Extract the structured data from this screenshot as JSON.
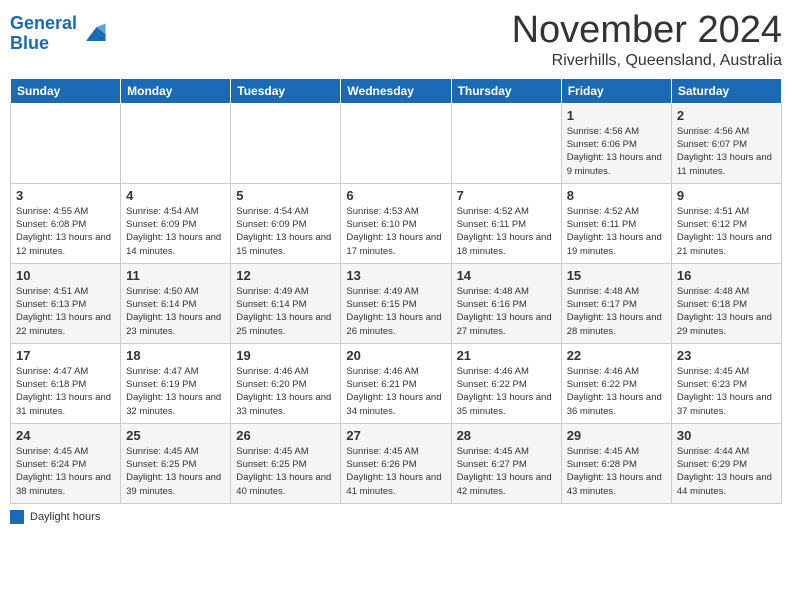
{
  "header": {
    "logo_line1": "General",
    "logo_line2": "Blue",
    "month": "November 2024",
    "location": "Riverhills, Queensland, Australia"
  },
  "days_of_week": [
    "Sunday",
    "Monday",
    "Tuesday",
    "Wednesday",
    "Thursday",
    "Friday",
    "Saturday"
  ],
  "weeks": [
    [
      {
        "day": "",
        "info": ""
      },
      {
        "day": "",
        "info": ""
      },
      {
        "day": "",
        "info": ""
      },
      {
        "day": "",
        "info": ""
      },
      {
        "day": "",
        "info": ""
      },
      {
        "day": "1",
        "info": "Sunrise: 4:56 AM\nSunset: 6:06 PM\nDaylight: 13 hours and 9 minutes."
      },
      {
        "day": "2",
        "info": "Sunrise: 4:56 AM\nSunset: 6:07 PM\nDaylight: 13 hours and 11 minutes."
      }
    ],
    [
      {
        "day": "3",
        "info": "Sunrise: 4:55 AM\nSunset: 6:08 PM\nDaylight: 13 hours and 12 minutes."
      },
      {
        "day": "4",
        "info": "Sunrise: 4:54 AM\nSunset: 6:09 PM\nDaylight: 13 hours and 14 minutes."
      },
      {
        "day": "5",
        "info": "Sunrise: 4:54 AM\nSunset: 6:09 PM\nDaylight: 13 hours and 15 minutes."
      },
      {
        "day": "6",
        "info": "Sunrise: 4:53 AM\nSunset: 6:10 PM\nDaylight: 13 hours and 17 minutes."
      },
      {
        "day": "7",
        "info": "Sunrise: 4:52 AM\nSunset: 6:11 PM\nDaylight: 13 hours and 18 minutes."
      },
      {
        "day": "8",
        "info": "Sunrise: 4:52 AM\nSunset: 6:11 PM\nDaylight: 13 hours and 19 minutes."
      },
      {
        "day": "9",
        "info": "Sunrise: 4:51 AM\nSunset: 6:12 PM\nDaylight: 13 hours and 21 minutes."
      }
    ],
    [
      {
        "day": "10",
        "info": "Sunrise: 4:51 AM\nSunset: 6:13 PM\nDaylight: 13 hours and 22 minutes."
      },
      {
        "day": "11",
        "info": "Sunrise: 4:50 AM\nSunset: 6:14 PM\nDaylight: 13 hours and 23 minutes."
      },
      {
        "day": "12",
        "info": "Sunrise: 4:49 AM\nSunset: 6:14 PM\nDaylight: 13 hours and 25 minutes."
      },
      {
        "day": "13",
        "info": "Sunrise: 4:49 AM\nSunset: 6:15 PM\nDaylight: 13 hours and 26 minutes."
      },
      {
        "day": "14",
        "info": "Sunrise: 4:48 AM\nSunset: 6:16 PM\nDaylight: 13 hours and 27 minutes."
      },
      {
        "day": "15",
        "info": "Sunrise: 4:48 AM\nSunset: 6:17 PM\nDaylight: 13 hours and 28 minutes."
      },
      {
        "day": "16",
        "info": "Sunrise: 4:48 AM\nSunset: 6:18 PM\nDaylight: 13 hours and 29 minutes."
      }
    ],
    [
      {
        "day": "17",
        "info": "Sunrise: 4:47 AM\nSunset: 6:18 PM\nDaylight: 13 hours and 31 minutes."
      },
      {
        "day": "18",
        "info": "Sunrise: 4:47 AM\nSunset: 6:19 PM\nDaylight: 13 hours and 32 minutes."
      },
      {
        "day": "19",
        "info": "Sunrise: 4:46 AM\nSunset: 6:20 PM\nDaylight: 13 hours and 33 minutes."
      },
      {
        "day": "20",
        "info": "Sunrise: 4:46 AM\nSunset: 6:21 PM\nDaylight: 13 hours and 34 minutes."
      },
      {
        "day": "21",
        "info": "Sunrise: 4:46 AM\nSunset: 6:22 PM\nDaylight: 13 hours and 35 minutes."
      },
      {
        "day": "22",
        "info": "Sunrise: 4:46 AM\nSunset: 6:22 PM\nDaylight: 13 hours and 36 minutes."
      },
      {
        "day": "23",
        "info": "Sunrise: 4:45 AM\nSunset: 6:23 PM\nDaylight: 13 hours and 37 minutes."
      }
    ],
    [
      {
        "day": "24",
        "info": "Sunrise: 4:45 AM\nSunset: 6:24 PM\nDaylight: 13 hours and 38 minutes."
      },
      {
        "day": "25",
        "info": "Sunrise: 4:45 AM\nSunset: 6:25 PM\nDaylight: 13 hours and 39 minutes."
      },
      {
        "day": "26",
        "info": "Sunrise: 4:45 AM\nSunset: 6:25 PM\nDaylight: 13 hours and 40 minutes."
      },
      {
        "day": "27",
        "info": "Sunrise: 4:45 AM\nSunset: 6:26 PM\nDaylight: 13 hours and 41 minutes."
      },
      {
        "day": "28",
        "info": "Sunrise: 4:45 AM\nSunset: 6:27 PM\nDaylight: 13 hours and 42 minutes."
      },
      {
        "day": "29",
        "info": "Sunrise: 4:45 AM\nSunset: 6:28 PM\nDaylight: 13 hours and 43 minutes."
      },
      {
        "day": "30",
        "info": "Sunrise: 4:44 AM\nSunset: 6:29 PM\nDaylight: 13 hours and 44 minutes."
      }
    ]
  ],
  "legend": {
    "box_label": "Daylight hours"
  }
}
